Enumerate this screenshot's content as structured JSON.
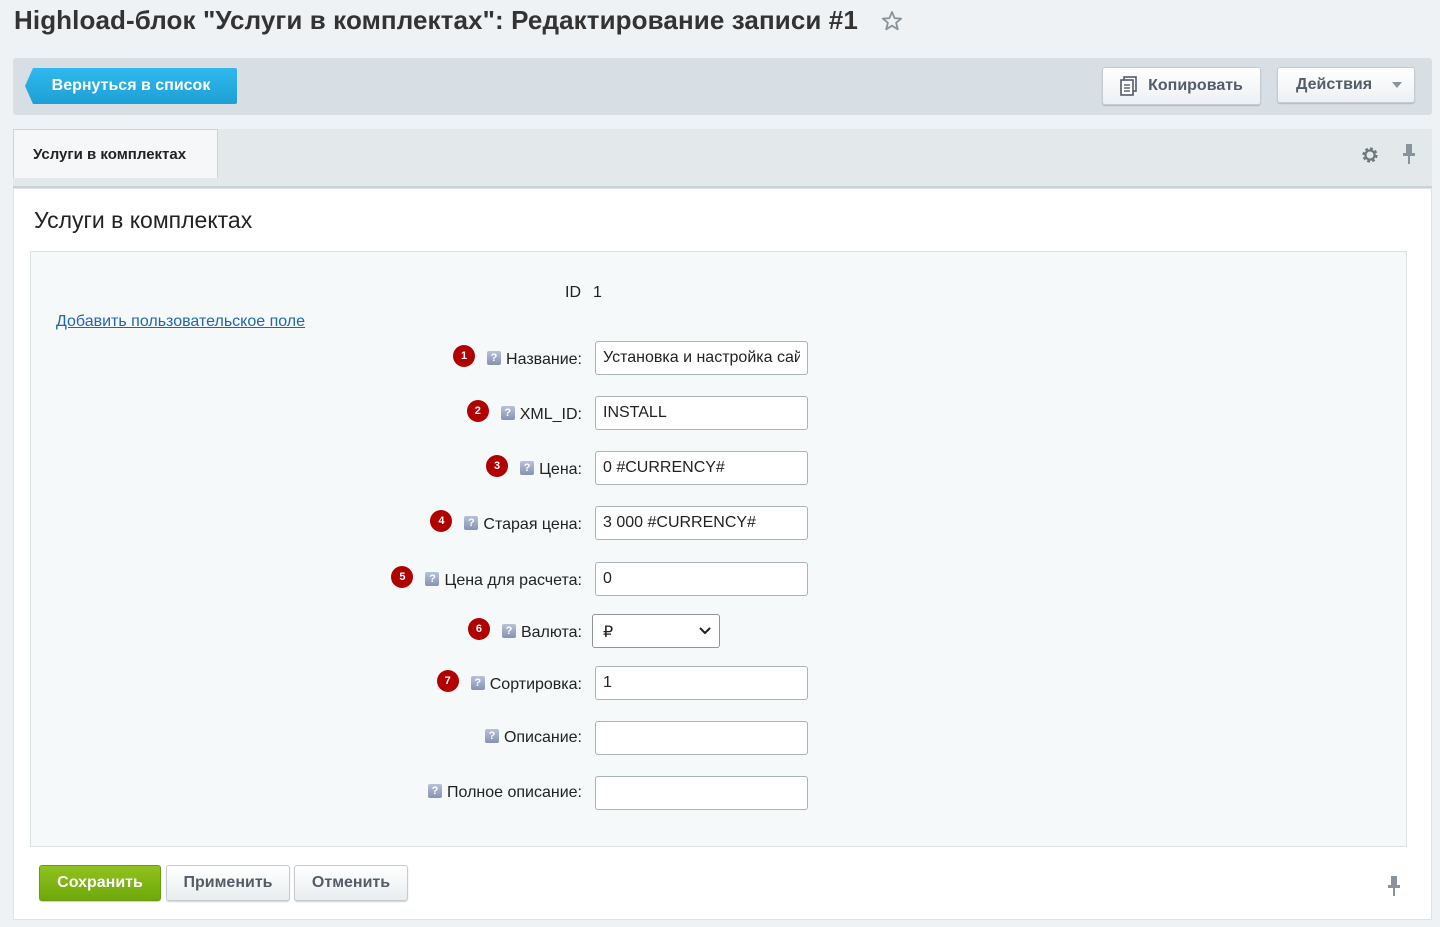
{
  "page": {
    "title": "Highload-блок \"Услуги в комплектах\": Редактирование записи #1",
    "favorite_icon": "star-icon"
  },
  "toolbar": {
    "back_label": "Вернуться в список",
    "copy_label": "Копировать",
    "actions_label": "Действия"
  },
  "tabs": [
    {
      "label": "Услуги в комплектах",
      "active": true
    }
  ],
  "section": {
    "title": "Услуги в комплектах",
    "id_label": "ID",
    "id_value": "1",
    "add_field_link": "Добавить пользовательское поле"
  },
  "fields": [
    {
      "badge": "1",
      "label": "Название:",
      "value": "Установка и настройка сайта"
    },
    {
      "badge": "2",
      "label": "XML_ID:",
      "value": "INSTALL"
    },
    {
      "badge": "3",
      "label": "Цена:",
      "value": "0 #CURRENCY#"
    },
    {
      "badge": "4",
      "label": "Старая цена:",
      "value": "3 000 #CURRENCY#"
    },
    {
      "badge": "5",
      "label": "Цена для расчета:",
      "value": "0"
    },
    {
      "badge": "6",
      "label": "Валюта:",
      "value": "₽"
    },
    {
      "badge": "7",
      "label": "Сортировка:",
      "value": "1"
    },
    {
      "badge": "",
      "label": "Описание:",
      "value": ""
    },
    {
      "badge": "",
      "label": "Полное описание:",
      "value": ""
    }
  ],
  "help_glyph": "?",
  "footer": {
    "save_label": "Сохранить",
    "apply_label": "Применить",
    "cancel_label": "Отменить"
  },
  "colors": {
    "accent_blue": "#1e9fd5",
    "save_green": "#7ab313",
    "badge_red": "#b10000",
    "link_blue": "#2067b0"
  }
}
